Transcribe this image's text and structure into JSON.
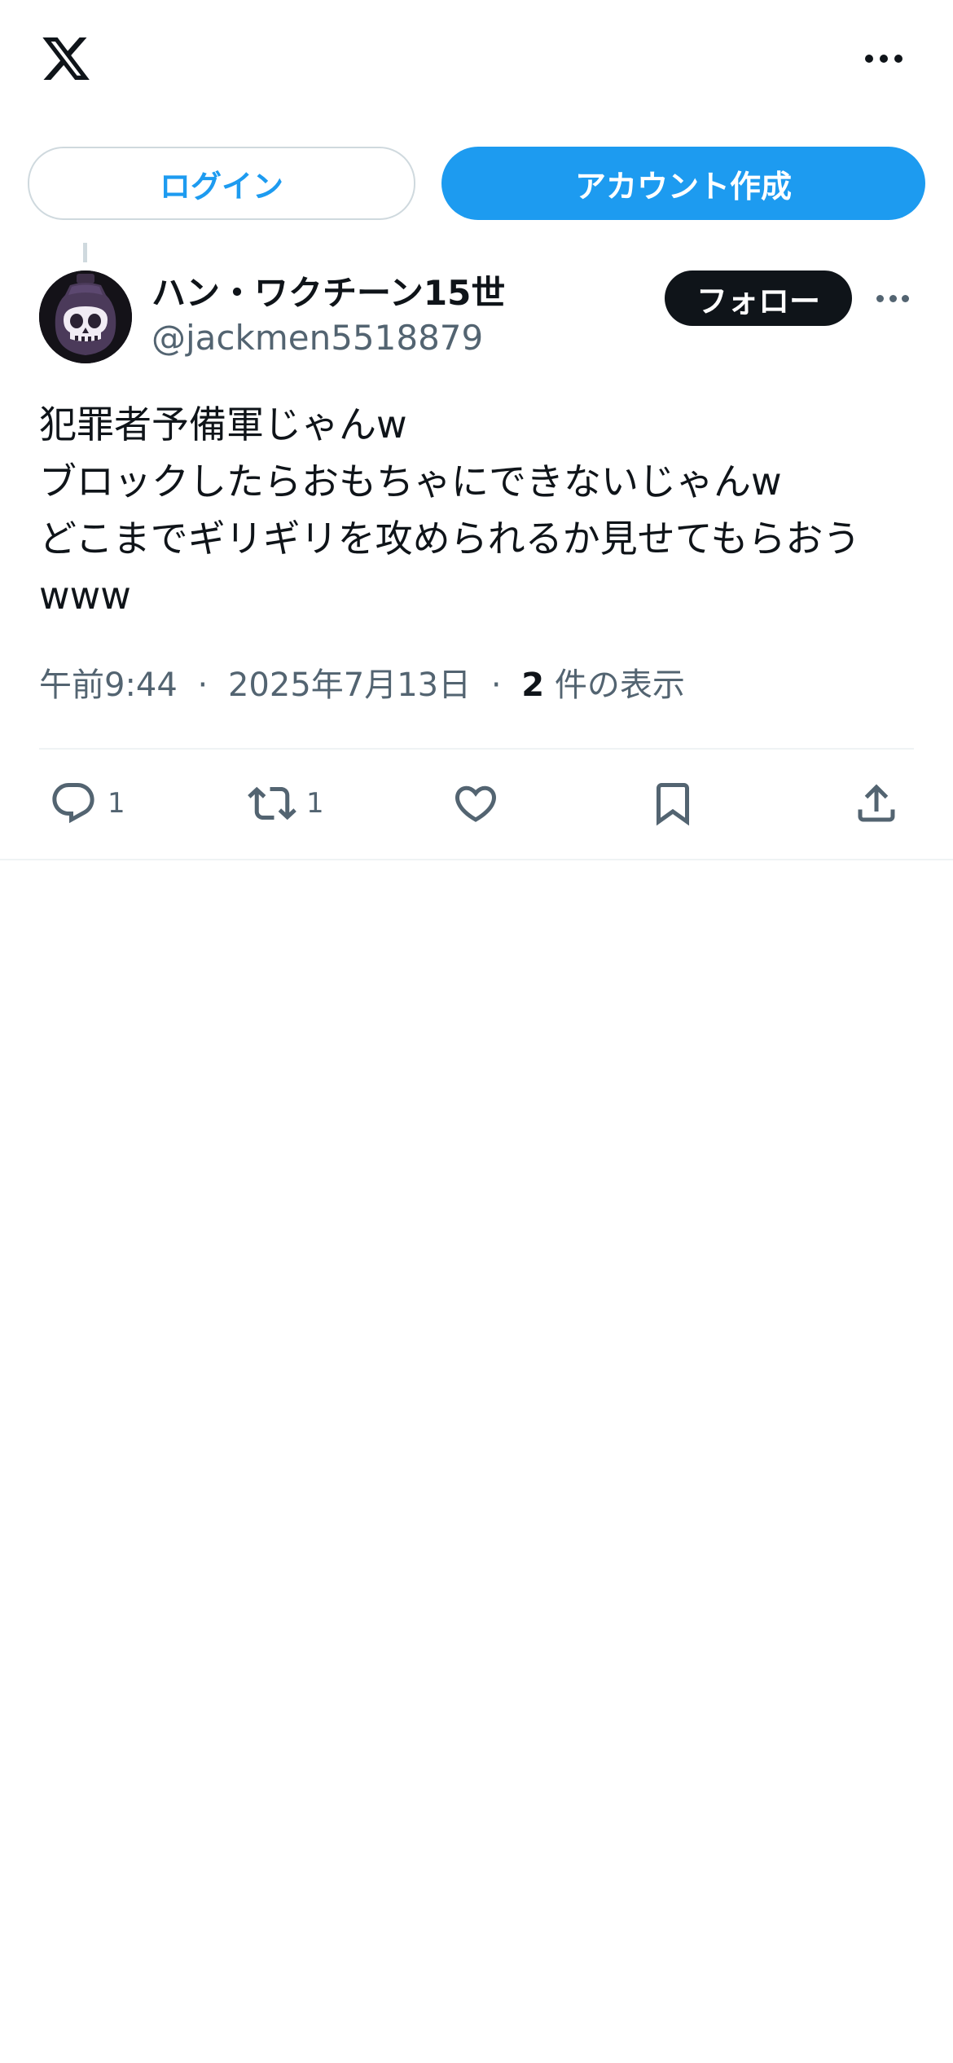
{
  "header": {
    "logo_icon": "x-logo-icon",
    "more_icon": "more-horizontal-icon"
  },
  "auth": {
    "login_label": "ログイン",
    "signup_label": "アカウント作成"
  },
  "post": {
    "author": {
      "display_name": "ハン・ワクチーン15世",
      "handle": "@jackmen5518879",
      "avatar_icon": "skull-bottle-avatar"
    },
    "follow_label": "フォロー",
    "text_lines": [
      "犯罪者予備軍じゃんw",
      "ブロックしたらおもちゃにできないじゃんw",
      "どこまでギリギリを攻められるか見せてもらおう",
      "www"
    ],
    "time": "午前9:44",
    "date": "2025年7月13日",
    "separator": "·",
    "views_count": "2",
    "views_label": "件の表示",
    "actions": {
      "reply_count": "1",
      "repost_count": "1"
    }
  },
  "colors": {
    "accent": "#1d9bf0",
    "text_primary": "#0f1419",
    "text_secondary": "#536471",
    "border": "#cfd9de",
    "divider": "#eff3f4"
  }
}
